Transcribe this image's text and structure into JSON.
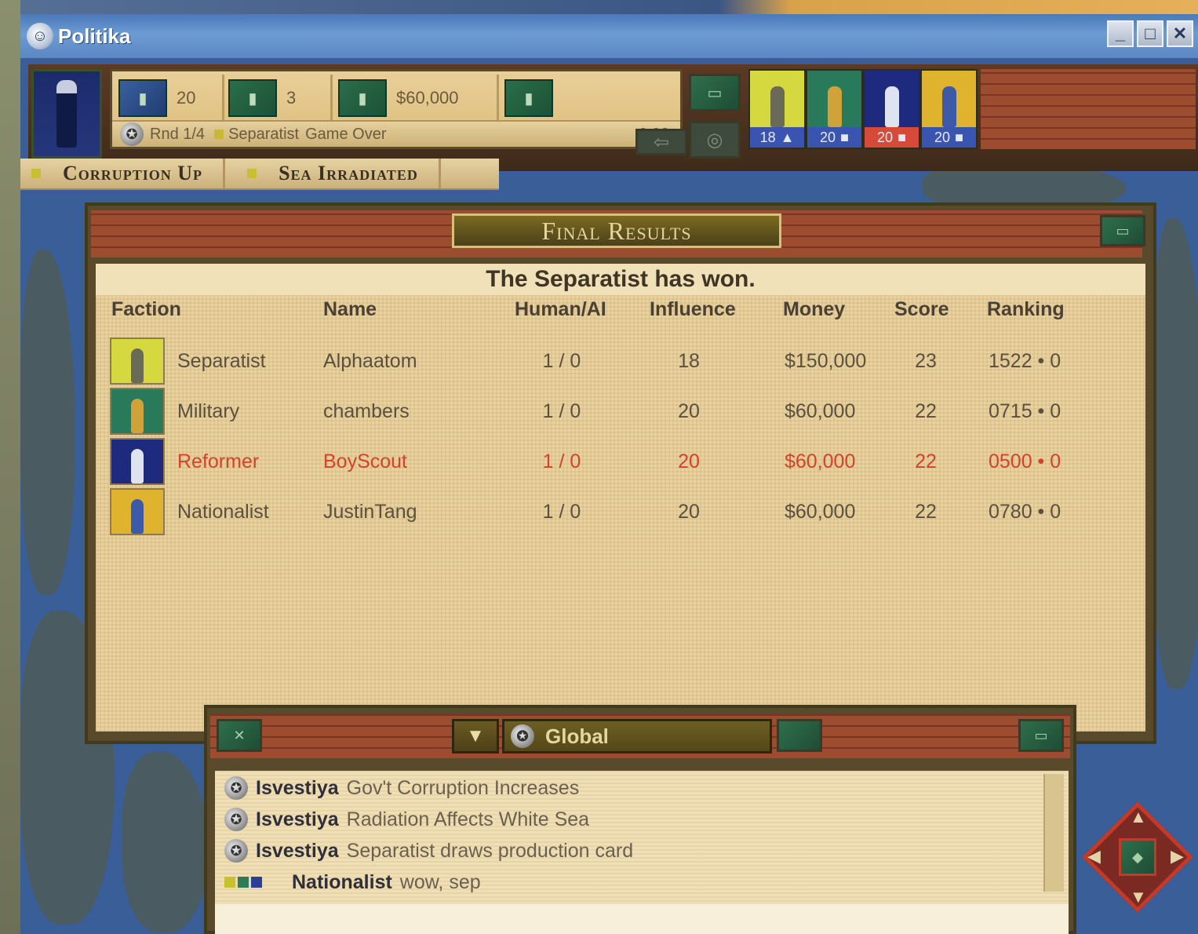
{
  "window": {
    "title": "Politika",
    "app_icon": "globe-app-icon",
    "controls": [
      "minimize",
      "maximize",
      "close"
    ],
    "control_glyphs": [
      "_",
      "□",
      "✕"
    ]
  },
  "toolbar": {
    "stats": [
      {
        "icon": "influence-icon",
        "glyph": "▮",
        "value": "20"
      },
      {
        "icon": "cards-icon",
        "glyph": "▮",
        "value": "3"
      },
      {
        "icon": "money-icon",
        "glyph": "▮",
        "value": "$60,000"
      },
      {
        "icon": "action-icon",
        "glyph": "▮",
        "value": ""
      }
    ],
    "status": {
      "round": "Rnd 1/4",
      "faction": "Separatist",
      "state": "Game Over",
      "timer": "0:00"
    },
    "factions": [
      {
        "name": "Separatist",
        "count": "18",
        "bg": "#d6d840",
        "fig": "#6a6a56",
        "bar": "#3a55b0"
      },
      {
        "name": "Military",
        "count": "20",
        "bg": "#287a5a",
        "fig": "#d0a23a",
        "bar": "#3a55b0"
      },
      {
        "name": "Reformer",
        "count": "20",
        "bg": "#1d2a7e",
        "fig": "#dfe3f0",
        "bar": "#d74a3a"
      },
      {
        "name": "Nationalist",
        "count": "20",
        "bg": "#e0b32e",
        "fig": "#3d5aa8",
        "bar": "#3a55b0"
      }
    ]
  },
  "events": [
    {
      "label": "Corruption Up"
    },
    {
      "label": "Sea Irradiated"
    }
  ],
  "dialog": {
    "title": "Final Results",
    "winner": "The Separatist has won.",
    "columns": {
      "faction": "Faction",
      "name": "Name",
      "human_ai": "Human/AI",
      "influence": "Influence",
      "money": "Money",
      "score": "Score",
      "ranking": "Ranking"
    },
    "rows": [
      {
        "faction": "Separatist",
        "name": "Alphaatom",
        "human_ai": "1 / 0",
        "influence": "18",
        "money": "$150,000",
        "score": "23",
        "ranking": "1522 • 0"
      },
      {
        "faction": "Military",
        "name": "chambers",
        "human_ai": "1 / 0",
        "influence": "20",
        "money": "$60,000",
        "score": "22",
        "ranking": "0715 • 0"
      },
      {
        "faction": "Reformer",
        "name": "BoyScout",
        "human_ai": "1 / 0",
        "influence": "20",
        "money": "$60,000",
        "score": "22",
        "ranking": "0500 • 0"
      },
      {
        "faction": "Nationalist",
        "name": "JustinTang",
        "human_ai": "1 / 0",
        "influence": "20",
        "money": "$60,000",
        "score": "22",
        "ranking": "0780 • 0"
      }
    ],
    "highlight_color": "#d2422c"
  },
  "chat": {
    "channel": "Global",
    "dropdown_glyph": "▼",
    "messages": [
      {
        "source": "Isvestiya",
        "text": "Gov't Corruption Increases"
      },
      {
        "source": "Isvestiya",
        "text": "Radiation Affects White Sea"
      },
      {
        "source": "Isvestiya",
        "text": "Separatist draws production card"
      },
      {
        "source": "Nationalist",
        "text": "wow, sep"
      }
    ]
  },
  "compass": {
    "center_glyph": "◆"
  }
}
